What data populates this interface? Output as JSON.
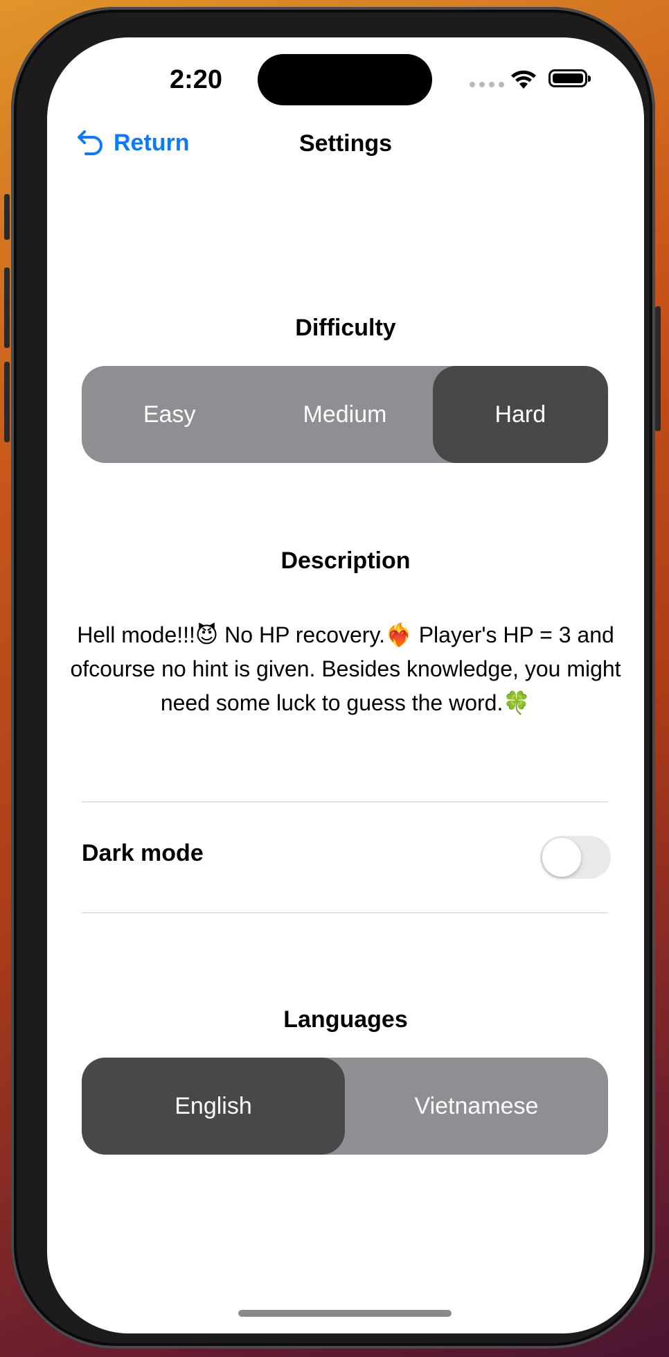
{
  "status_bar": {
    "time": "2:20"
  },
  "nav": {
    "back_label": "Return",
    "title": "Settings"
  },
  "difficulty": {
    "heading": "Difficulty",
    "options": [
      "Easy",
      "Medium",
      "Hard"
    ],
    "selected": "Hard"
  },
  "description": {
    "heading": "Description",
    "text": "Hell mode!!!😈 No HP recovery.❤️‍🔥 Player's HP = 3 and ofcourse no hint is given. Besides knowledge, you might need some luck to guess the word.🍀"
  },
  "dark_mode": {
    "label": "Dark mode",
    "enabled": false
  },
  "languages": {
    "heading": "Languages",
    "options": [
      "English",
      "Vietnamese"
    ],
    "selected": "English"
  },
  "colors": {
    "accent": "#0a7aff",
    "segment_bg": "#8e8e93",
    "segment_selected": "#48484a"
  }
}
